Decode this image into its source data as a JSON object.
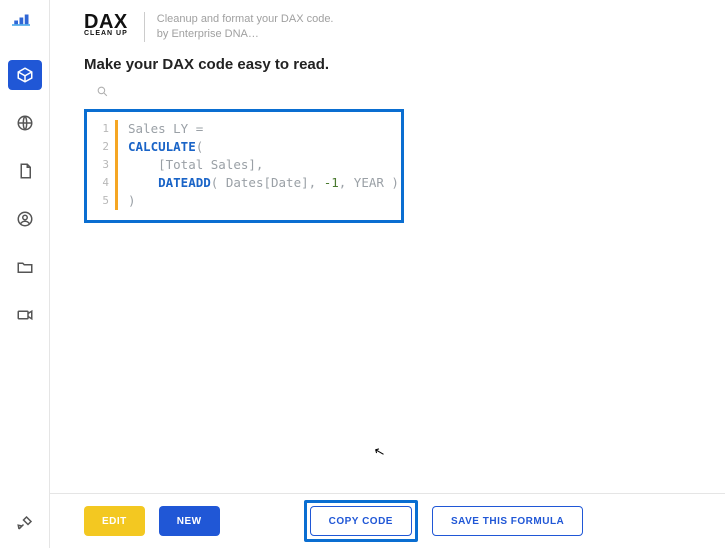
{
  "brand": {
    "main": "DAX",
    "sub": "CLEAN UP"
  },
  "tagline": {
    "line1": "Cleanup and format your DAX code.",
    "line2": "by Enterprise DNA…"
  },
  "heading": "Make your DAX code easy to read.",
  "code": {
    "lines": [
      {
        "num": "1",
        "segments": [
          {
            "cls": "tok-plain",
            "text": "Sales LY ="
          }
        ]
      },
      {
        "num": "2",
        "segments": [
          {
            "cls": "tok-kw",
            "text": "CALCULATE"
          },
          {
            "cls": "tok-plain",
            "text": "("
          }
        ]
      },
      {
        "num": "3",
        "segments": [
          {
            "cls": "tok-plain",
            "text": "    [Total Sales],"
          }
        ]
      },
      {
        "num": "4",
        "segments": [
          {
            "cls": "tok-plain",
            "text": "    "
          },
          {
            "cls": "tok-kw",
            "text": "DATEADD"
          },
          {
            "cls": "tok-plain",
            "text": "( Dates[Date], "
          },
          {
            "cls": "tok-num",
            "text": "-1"
          },
          {
            "cls": "tok-plain",
            "text": ", YEAR )"
          }
        ]
      },
      {
        "num": "5",
        "segments": [
          {
            "cls": "tok-plain",
            "text": ")"
          }
        ]
      }
    ]
  },
  "buttons": {
    "edit": "EDIT",
    "new": "NEW",
    "copy": "COPY CODE",
    "save": "SAVE THIS FORMULA"
  }
}
